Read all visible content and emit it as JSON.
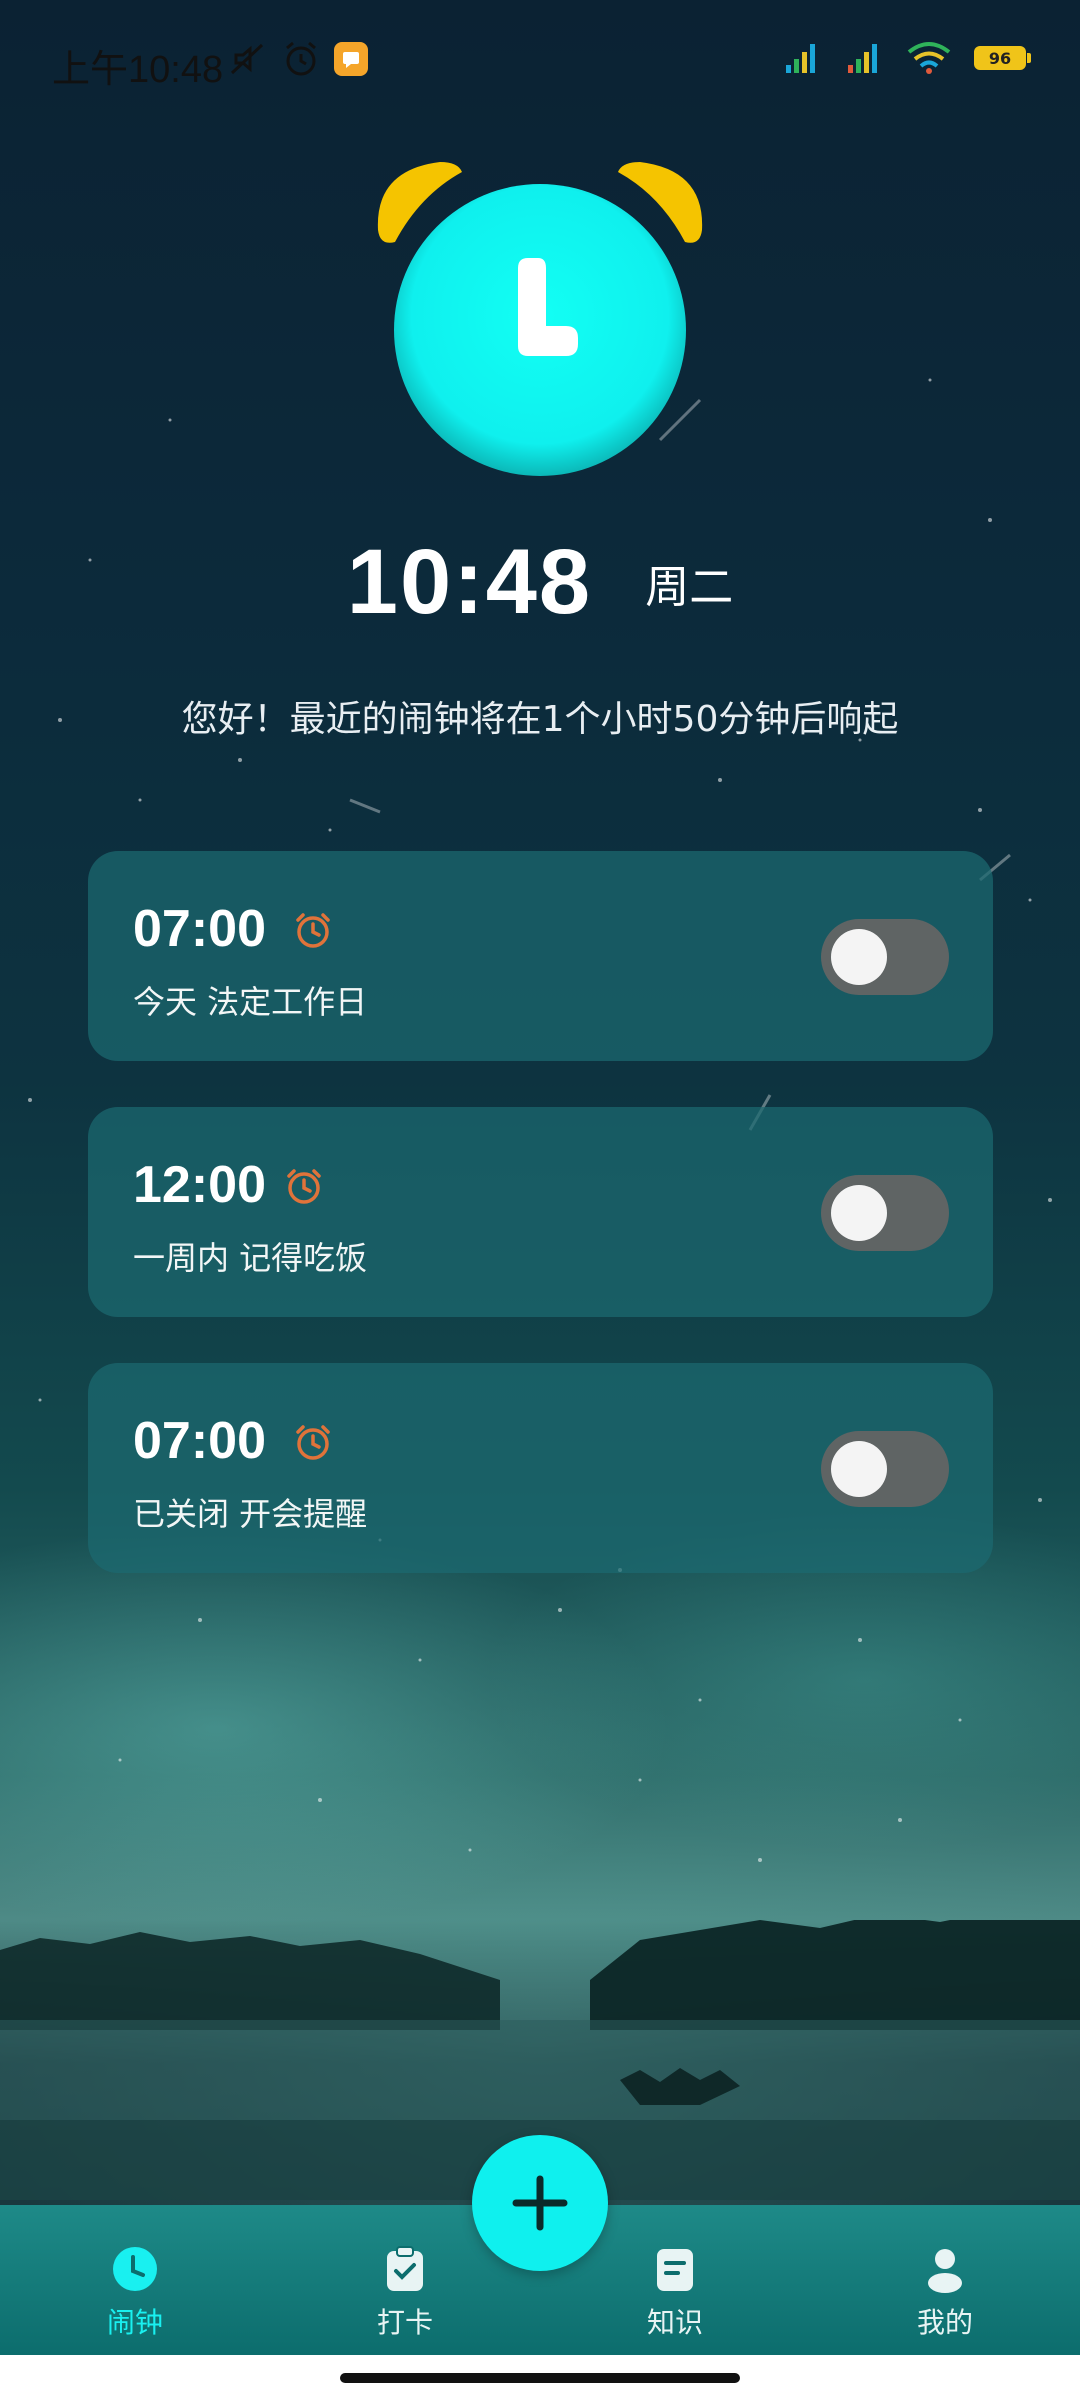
{
  "status_bar": {
    "time": "上午10:48",
    "battery": "96"
  },
  "clock": {
    "time": "10:48",
    "weekday": "周二"
  },
  "greeting": "您好！最近的闹钟将在1个小时50分钟后响起",
  "alarms": [
    {
      "time": "07:00",
      "description": "今天 法定工作日",
      "enabled": false
    },
    {
      "time": "12:00",
      "description": "一周内 记得吃饭",
      "enabled": false
    },
    {
      "time": "07:00",
      "description": "已关闭 开会提醒",
      "enabled": false
    }
  ],
  "nav": {
    "items": [
      {
        "label": "闹钟",
        "icon": "clock-icon",
        "active": true
      },
      {
        "label": "打卡",
        "icon": "clipboard-check-icon",
        "active": false
      },
      {
        "label": "知识",
        "icon": "book-icon",
        "active": false
      },
      {
        "label": "我的",
        "icon": "user-icon",
        "active": false
      }
    ]
  },
  "colors": {
    "accent": "#0ff0ee",
    "alarm_icon": "#e0733a",
    "bell": "#f5c400",
    "toggle_off": "#5f6464"
  }
}
